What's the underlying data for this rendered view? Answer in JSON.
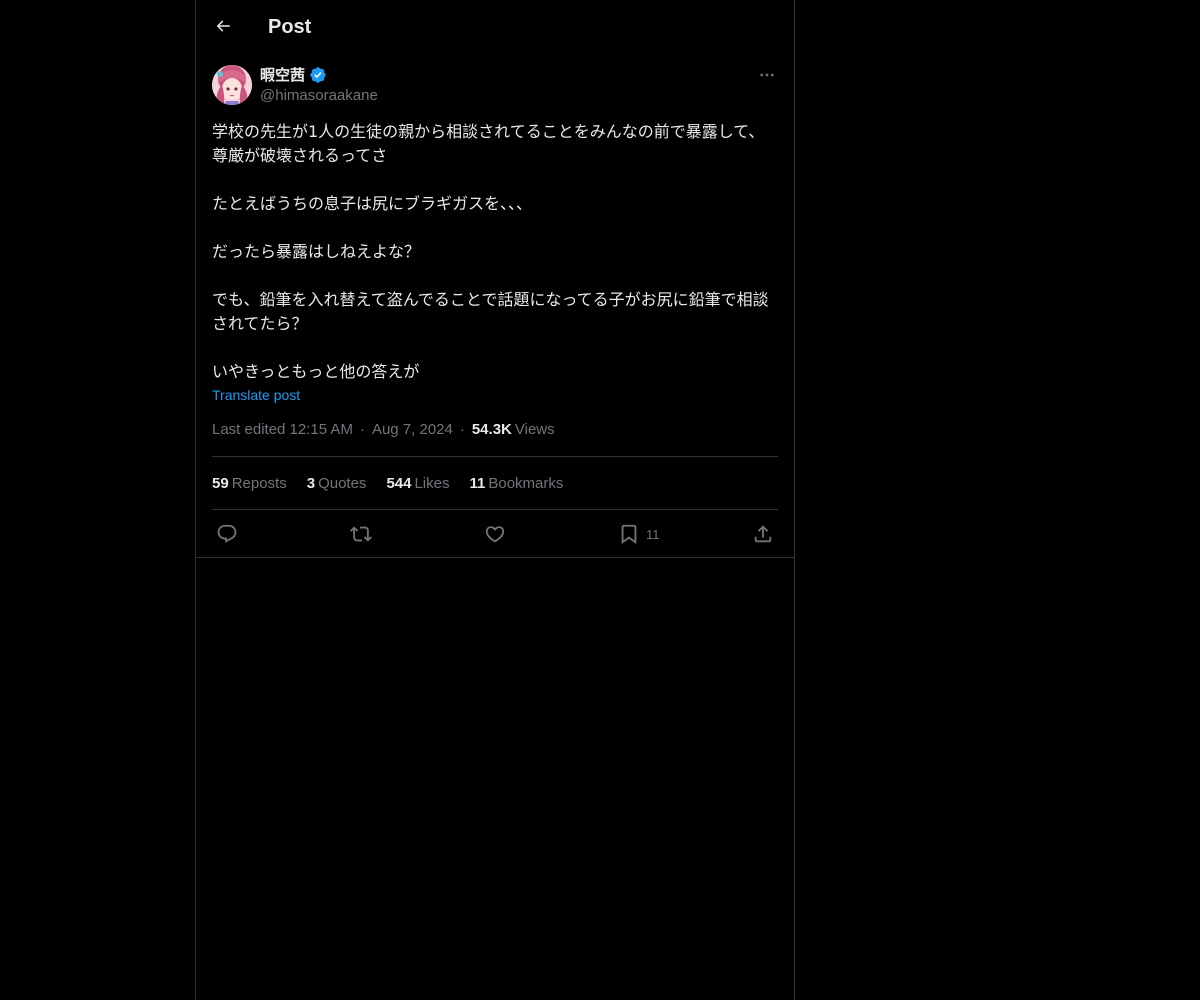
{
  "header": {
    "title": "Post",
    "back_icon": "arrow-left-icon"
  },
  "post": {
    "author": {
      "name": "暇空茜",
      "handle": "@himasoraakane",
      "verified": true,
      "verified_color": "#1d9bf0"
    },
    "paragraphs": [
      "学校の先生が1人の生徒の親から相談されてることをみんなの前で暴露して、尊厳が破壊されるってさ",
      "たとえばうちの息子は尻にブラギガスを、、、",
      "だったら暴露はしねえよな？",
      "でも、鉛筆を入れ替えて盗んでることで話題になってる子がお尻に鉛筆で相談されてたら？",
      "いやきっともっと他の答えが"
    ],
    "translate_label": "Translate post",
    "meta": {
      "edited": "Last edited 12:15 AM",
      "date": "Aug 7, 2024",
      "views_count": "54.3K",
      "views_label": "Views"
    },
    "stats": {
      "reposts_count": "59",
      "reposts_label": "Reposts",
      "quotes_count": "3",
      "quotes_label": "Quotes",
      "likes_count": "544",
      "likes_label": "Likes",
      "bookmarks_count": "11",
      "bookmarks_label": "Bookmarks"
    },
    "actions": {
      "bookmark_count": "11"
    }
  },
  "colors": {
    "background": "#000000",
    "text": "#e7e9ea",
    "secondary": "#71767b",
    "border": "#2f3336",
    "accent": "#1d9bf0"
  }
}
